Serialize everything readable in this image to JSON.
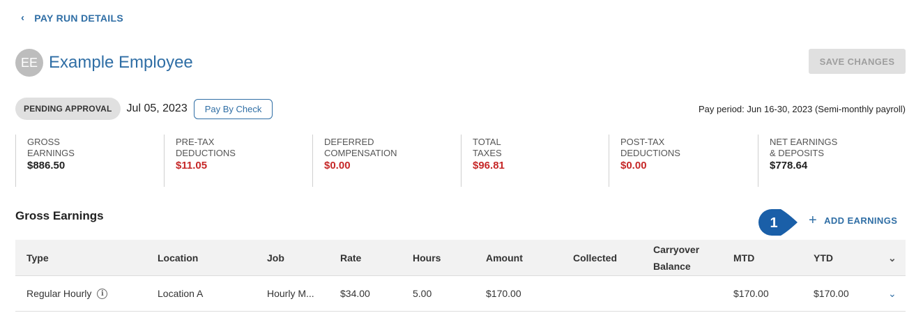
{
  "nav": {
    "back_label": "PAY RUN DETAILS"
  },
  "employee": {
    "initials": "EE",
    "name": "Example Employee"
  },
  "actions": {
    "save_label": "SAVE CHANGES"
  },
  "status": {
    "chip": "PENDING APPROVAL",
    "date": "Jul 05, 2023",
    "method_label": "Pay By Check",
    "pay_period": "Pay period: Jun 16-30, 2023 (Semi-monthly payroll)"
  },
  "summary": [
    {
      "label": "GROSS EARNINGS",
      "value": "$886.50"
    },
    {
      "label": "PRE-TAX DEDUCTIONS",
      "value": "$11.05"
    },
    {
      "label": "DEFERRED COMPENSATION",
      "value": "$0.00"
    },
    {
      "label": "TOTAL TAXES",
      "value": "$96.81"
    },
    {
      "label": "POST-TAX DEDUCTIONS",
      "value": "$0.00"
    },
    {
      "label": "NET EARNINGS & DEPOSITS",
      "value": "$778.64"
    }
  ],
  "earnings": {
    "title": "Gross Earnings",
    "callout_number": "1",
    "add_label": "ADD EARNINGS",
    "columns": {
      "type": "Type",
      "location": "Location",
      "job": "Job",
      "rate": "Rate",
      "hours": "Hours",
      "amount": "Amount",
      "collected": "Collected",
      "carryover_1": "Carryover",
      "carryover_2": "Balance",
      "mtd": "MTD",
      "ytd": "YTD"
    },
    "rows": [
      {
        "type": "Regular Hourly",
        "location": "Location A",
        "job": "Hourly M...",
        "rate": "$34.00",
        "hours": "5.00",
        "amount": "$170.00",
        "collected": "",
        "carryover": "",
        "mtd": "$170.00",
        "ytd": "$170.00"
      }
    ]
  },
  "colors": {
    "accent": "#2f6ea5",
    "negative": "#c62828",
    "callout": "#1a5fa8"
  },
  "icons": [
    "chevron-left-icon",
    "info-icon",
    "plus-icon",
    "chevron-down-icon"
  ]
}
